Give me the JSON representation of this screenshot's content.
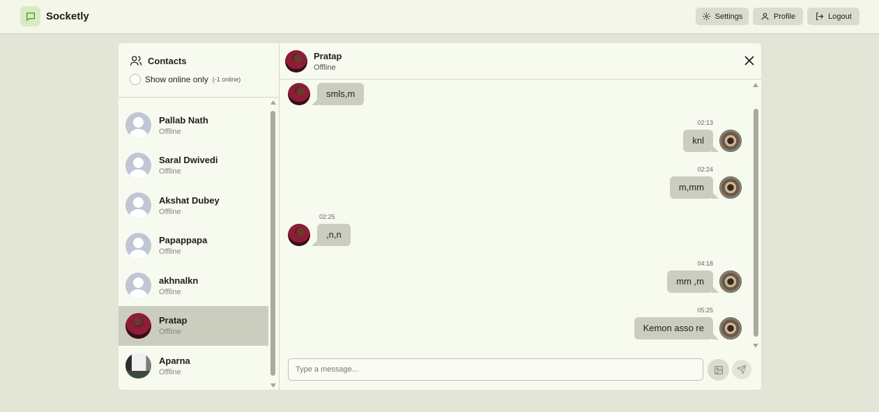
{
  "app": {
    "name": "Socketly"
  },
  "nav": {
    "settings_label": "Settings",
    "profile_label": "Profile",
    "logout_label": "Logout"
  },
  "sidebar": {
    "title": "Contacts",
    "filter_label": "Show online only",
    "online_count": "(-1 online)",
    "contacts": [
      {
        "name": "Pallab Nath",
        "status": "Offline",
        "avatar": "default-user-icon"
      },
      {
        "name": "Saral Dwivedi",
        "status": "Offline",
        "avatar": "default-user-icon"
      },
      {
        "name": "Akshat Dubey",
        "status": "Offline",
        "avatar": "default-user-icon"
      },
      {
        "name": "Papappapa",
        "status": "Offline",
        "avatar": "default-user-icon"
      },
      {
        "name": "akhnalkn",
        "status": "Offline",
        "avatar": "default-user-icon"
      },
      {
        "name": "Pratap",
        "status": "Offline",
        "avatar": "photo",
        "active": true
      },
      {
        "name": "Aparna",
        "status": "Offline",
        "avatar": "photo"
      }
    ]
  },
  "chat": {
    "name": "Pratap",
    "status": "Offline",
    "messages": [
      {
        "side": "left",
        "text": "smls,m",
        "time": ""
      },
      {
        "side": "right",
        "text": "knl",
        "time": "02:13"
      },
      {
        "side": "right",
        "text": "m,mm",
        "time": "02:24"
      },
      {
        "side": "left",
        "text": ",n,n",
        "time": "02:25"
      },
      {
        "side": "right",
        "text": "mm ,m",
        "time": "04:18"
      },
      {
        "side": "right",
        "text": "Kemon asso re",
        "time": "05:25"
      }
    ],
    "input_placeholder": "Type a message..."
  },
  "colors": {
    "background": "#e3e6d7",
    "panel": "#f7faee",
    "bubble": "#cbcdbf",
    "accent": "#5aa02c"
  }
}
